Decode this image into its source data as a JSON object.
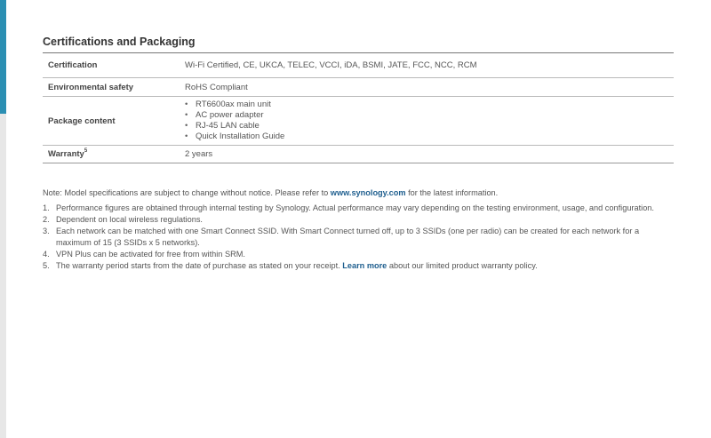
{
  "section": {
    "title": "Certifications and Packaging"
  },
  "specs": {
    "certification": {
      "label": "Certification",
      "value": "Wi-Fi Certified, CE, UKCA, TELEC, VCCI, iDA, BSMI, JATE, FCC, NCC, RCM"
    },
    "environmental": {
      "label": "Environmental safety",
      "value": "RoHS Compliant"
    },
    "package": {
      "label": "Package content",
      "items": [
        "RT6600ax main unit",
        "AC power adapter",
        "RJ-45 LAN cable",
        "Quick Installation Guide"
      ]
    },
    "warranty": {
      "label": "Warranty",
      "sup": "5",
      "value": "2 years"
    }
  },
  "notes": {
    "intro_before": "Note: Model specifications are subject to change without notice. Please refer to ",
    "intro_link": "www.synology.com",
    "intro_after": " for the latest information.",
    "items": [
      {
        "num": "1.",
        "text": "Performance figures are obtained through internal testing by Synology. Actual performance may vary depending on the testing environment, usage, and configuration."
      },
      {
        "num": "2.",
        "text": "Dependent on local wireless regulations."
      },
      {
        "num": "3.",
        "text": "Each network can be matched with one Smart Connect SSID. With Smart Connect turned off, up to 3 SSIDs (one per radio) can be created for each network for a maximum of 15 (3 SSIDs x 5 networks)."
      },
      {
        "num": "4.",
        "text": "VPN Plus can be activated for free from within SRM."
      },
      {
        "num": "5.",
        "text_before": "The warranty period starts from the date of purchase as stated on your receipt. ",
        "link": "Learn more",
        "text_after": " about our limited product warranty policy."
      }
    ]
  },
  "colors": {
    "accent": "#2b8fb3",
    "link": "#1f5f8f",
    "rail": "#e7e7e7"
  }
}
